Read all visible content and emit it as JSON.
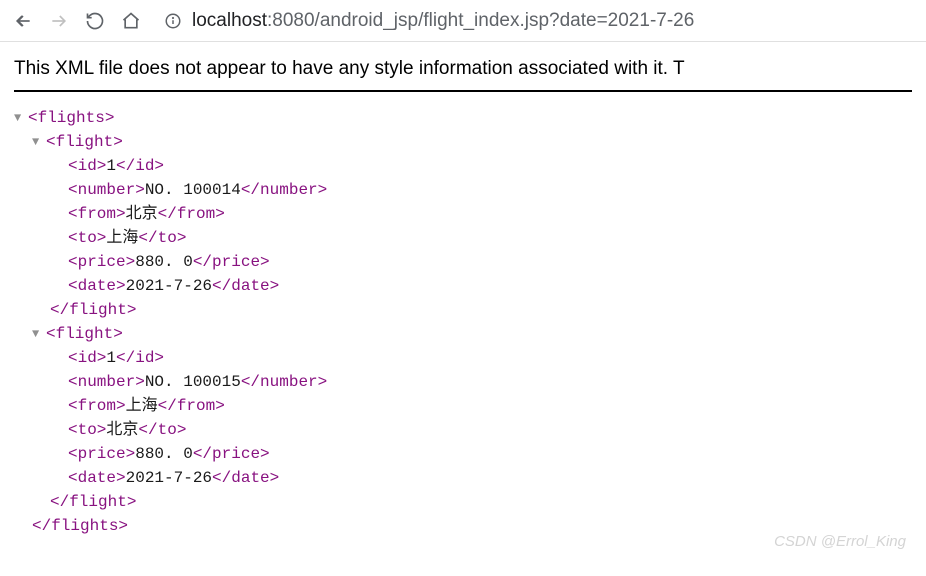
{
  "toolbar": {
    "url_host": "localhost",
    "url_rest": ":8080/android_jsp/flight_index.jsp?date=2021-7-26"
  },
  "banner": "This XML file does not appear to have any style information associated with it. T",
  "xml": {
    "root_open": "<flights>",
    "root_close": "</flights>",
    "flight_open": "<flight>",
    "flight_close": "</flight>",
    "tags": {
      "id_open": "<id>",
      "id_close": "</id>",
      "number_open": "<number>",
      "number_close": "</number>",
      "from_open": "<from>",
      "from_close": "</from>",
      "to_open": "<to>",
      "to_close": "</to>",
      "price_open": "<price>",
      "price_close": "</price>",
      "date_open": "<date>",
      "date_close": "</date>"
    },
    "flights": [
      {
        "id": "1",
        "number": "NO. 100014",
        "from": "北京",
        "to": "上海",
        "price": "880. 0",
        "date": "2021-7-26"
      },
      {
        "id": "1",
        "number": "NO. 100015",
        "from": "上海",
        "to": "北京",
        "price": "880. 0",
        "date": "2021-7-26"
      }
    ]
  },
  "watermark": "CSDN @Errol_King"
}
